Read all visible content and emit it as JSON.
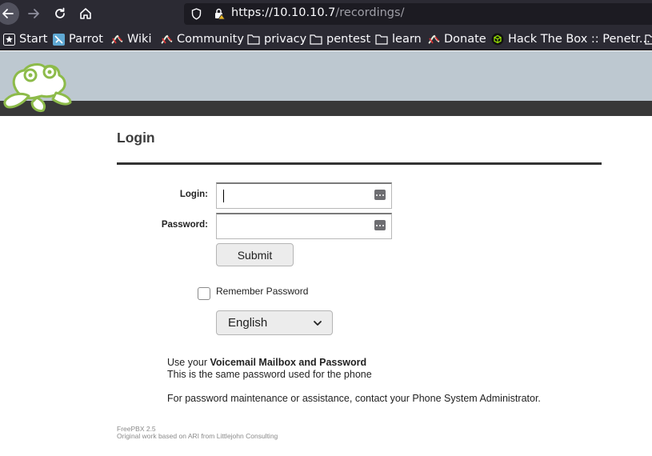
{
  "browser": {
    "url_host": "https://10.10.10.7",
    "url_path": "/recordings/",
    "bookmarks": [
      "Start",
      "Parrot",
      "Wiki",
      "Community",
      "privacy",
      "pentest",
      "learn",
      "Donate",
      "Hack The Box :: Penetr..."
    ]
  },
  "page": {
    "title": "Login",
    "login_label": "Login:",
    "password_label": "Password:",
    "login_value": "",
    "password_value": "",
    "submit_label": "Submit",
    "remember_label": "Remember Password",
    "language_selected": "English",
    "info_prefix": "Use your ",
    "info_bold": "Voicemail Mailbox and Password",
    "info_line2": "This is the same password used for the phone",
    "info_line3": "For password maintenance or assistance, contact your Phone System Administrator.",
    "footer_line1": "FreePBX 2.5",
    "footer_line2": "Original work based on ARI from Littlejohn Consulting"
  },
  "colors": {
    "header_bg": "#bdc8d0",
    "header_bar": "#383838",
    "logo_green": "#8dbb4a"
  },
  "icons": {
    "back": "arrow-left-icon",
    "forward": "arrow-right-icon",
    "reload": "reload-icon",
    "home": "home-icon",
    "shield": "shield-icon",
    "lock": "insecure-lock-icon",
    "password_manager": "key-dots-icon",
    "dropdown": "chevron-down-icon"
  }
}
